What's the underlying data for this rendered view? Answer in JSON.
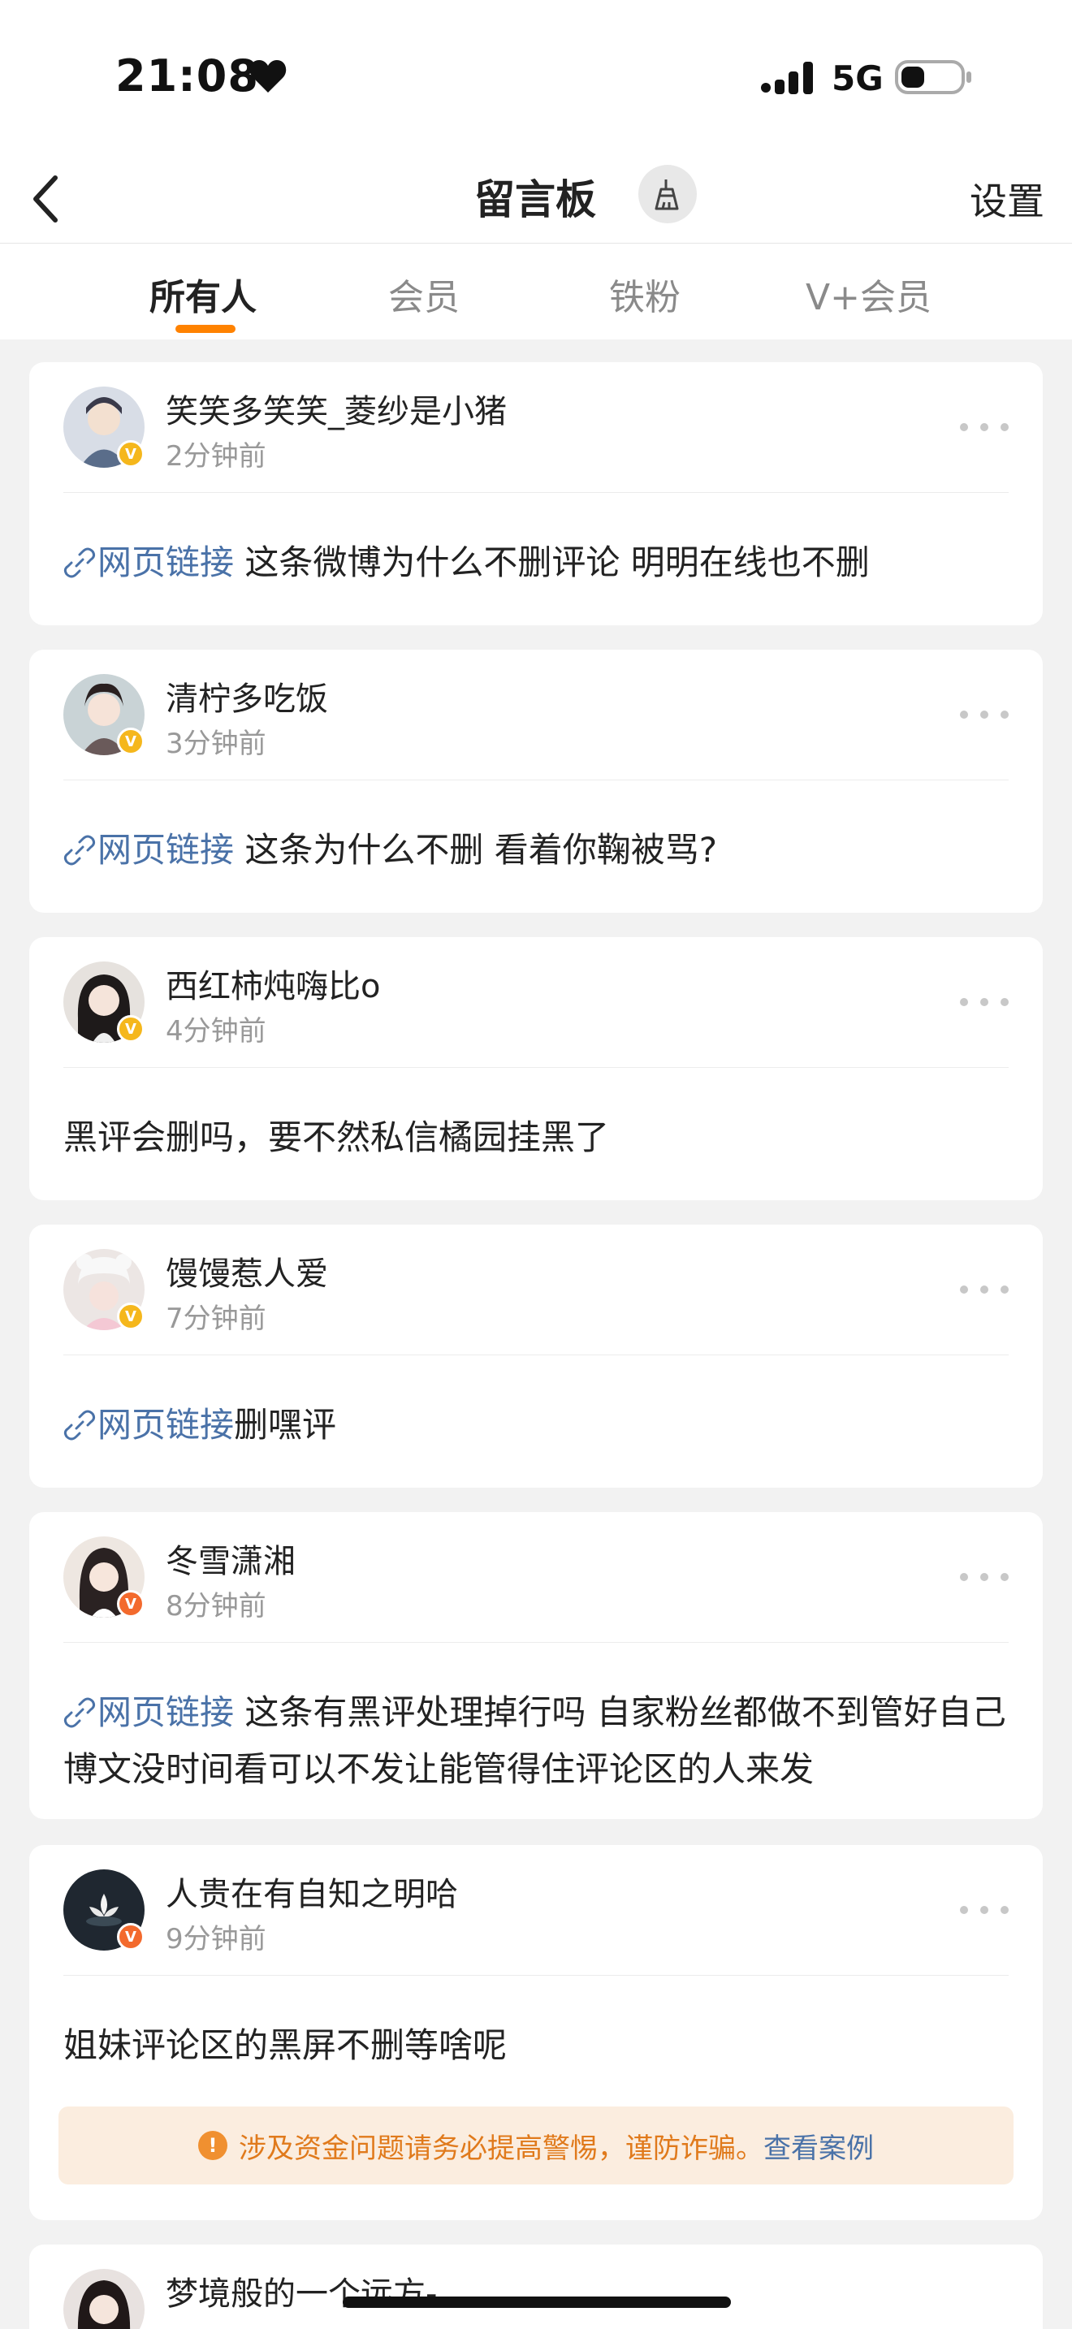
{
  "status_bar": {
    "time": "21:08",
    "network": "5G",
    "icons": [
      "heart-icon",
      "signal-icon",
      "battery-icon"
    ]
  },
  "nav": {
    "title": "留言板",
    "settings_label": "设置",
    "icons": [
      "back-icon",
      "broom-icon"
    ]
  },
  "tabs": [
    {
      "label": "所有人",
      "active": true
    },
    {
      "label": "会员",
      "active": false
    },
    {
      "label": "铁粉",
      "active": false
    },
    {
      "label": "V+会员",
      "active": false
    }
  ],
  "colors": {
    "accent": "#ff8200",
    "link": "#4a72a8",
    "badge_gold": "#f5b71c",
    "badge_orange": "#f36a2d",
    "warning_bg": "#fbeddf",
    "warning_text": "#e07a1c"
  },
  "posts": [
    {
      "username": "笑笑多笑笑_菱纱是小猪",
      "time": "2分钟前",
      "badge": "V",
      "badge_color": "gold",
      "link_label": "网页链接",
      "text": " 这条微博为什么不删评论 明明在线也不删"
    },
    {
      "username": "清柠多吃饭",
      "time": "3分钟前",
      "badge": "V",
      "badge_color": "gold",
      "link_label": "网页链接",
      "text": " 这条为什么不删 看着你鞠被骂?"
    },
    {
      "username": "西红柿炖嗨比o",
      "time": "4分钟前",
      "badge": "V",
      "badge_color": "gold",
      "link_label": "",
      "text": "黑评会删吗，要不然私信橘园挂黑了"
    },
    {
      "username": "馒馒惹人爱",
      "time": "7分钟前",
      "badge": "V",
      "badge_color": "gold",
      "link_label": "网页链接",
      "text": "删嘿评"
    },
    {
      "username": "冬雪潇湘",
      "time": "8分钟前",
      "badge": "V",
      "badge_color": "orange",
      "link_label": "网页链接",
      "text": " 这条有黑评处理掉行吗 自家粉丝都做不到管好自己博文没时间看可以不发让能管得住评论区的人来发"
    },
    {
      "username": "人贵在有自知之明哈",
      "time": "9分钟前",
      "badge": "V",
      "badge_color": "orange",
      "link_label": "",
      "text": "姐妹评论区的黑屏不删等啥呢"
    },
    {
      "username": "梦境般的一个远方-",
      "time": "",
      "badge": "",
      "badge_color": "",
      "link_label": "",
      "text": ""
    }
  ],
  "warning": {
    "text": "涉及资金问题请务必提高警惕，谨防诈骗。",
    "link_label": "查看案例",
    "icon": "info-icon"
  }
}
